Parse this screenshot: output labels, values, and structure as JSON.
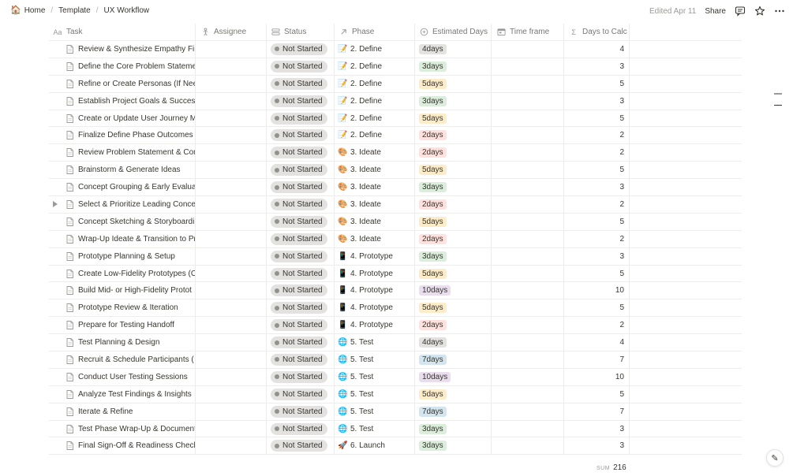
{
  "breadcrumb": {
    "items": [
      {
        "label": "Home",
        "icon": "home-emoji-icon"
      },
      {
        "label": "Template"
      },
      {
        "label": "UX Workflow"
      }
    ],
    "separator": "/"
  },
  "topbar": {
    "edited": "Edited Apr 11",
    "share_label": "Share"
  },
  "columns": [
    {
      "key": "task",
      "label": "Task",
      "icon_text": "Aa"
    },
    {
      "key": "assignee",
      "label": "Assignee",
      "icon": "person-icon"
    },
    {
      "key": "status",
      "label": "Status",
      "icon": "status-icon"
    },
    {
      "key": "phase",
      "label": "Phase",
      "icon": "arrow-up-right-icon"
    },
    {
      "key": "est",
      "label": "Estimated Days",
      "icon": "formula-icon"
    },
    {
      "key": "time",
      "label": "Time frame",
      "icon": "calendar-icon"
    },
    {
      "key": "days",
      "label": "Days to Calc",
      "icon_text": "Σ"
    }
  ],
  "colors": {
    "phase_define": "#f3e7c3",
    "est_4": "#e3e2e0",
    "est_3": "#dbeddb",
    "est_5": "#fdecc8",
    "est_2": "#ffe2dd",
    "est_10": "#e8deee",
    "est_7": "#d3e5ef"
  },
  "rows": [
    {
      "task": "Review & Synthesize Empathy Fin",
      "status": "Not Started",
      "phase_emoji": "📝",
      "phase": "2. Define",
      "est": "4days",
      "est_color": "#e3e2e0",
      "days": "4"
    },
    {
      "task": "Define the Core Problem Stateme",
      "status": "Not Started",
      "phase_emoji": "📝",
      "phase": "2. Define",
      "est": "3days",
      "est_color": "#dbeddb",
      "days": "3"
    },
    {
      "task": "Refine or Create Personas (If Nee",
      "status": "Not Started",
      "phase_emoji": "📝",
      "phase": "2. Define",
      "est": "5days",
      "est_color": "#fdecc8",
      "days": "5"
    },
    {
      "task": "Establish Project Goals & Success",
      "status": "Not Started",
      "phase_emoji": "📝",
      "phase": "2. Define",
      "est": "3days",
      "est_color": "#dbeddb",
      "days": "3"
    },
    {
      "task": "Create or Update User Journey M",
      "status": "Not Started",
      "phase_emoji": "📝",
      "phase": "2. Define",
      "est": "5days",
      "est_color": "#fdecc8",
      "days": "5"
    },
    {
      "task": "Finalize Define Phase Outcomes &",
      "status": "Not Started",
      "phase_emoji": "📝",
      "phase": "2. Define",
      "est": "2days",
      "est_color": "#ffe2dd",
      "days": "2"
    },
    {
      "task": "Review Problem Statement & Con",
      "status": "Not Started",
      "phase_emoji": "🎨",
      "phase": "3. Ideate",
      "est": "2days",
      "est_color": "#ffe2dd",
      "days": "2"
    },
    {
      "task": "Brainstorm & Generate Ideas",
      "status": "Not Started",
      "phase_emoji": "🎨",
      "phase": "3. Ideate",
      "est": "5days",
      "est_color": "#fdecc8",
      "days": "5"
    },
    {
      "task": "Concept Grouping & Early Evaluat",
      "status": "Not Started",
      "phase_emoji": "🎨",
      "phase": "3. Ideate",
      "est": "3days",
      "est_color": "#dbeddb",
      "days": "3"
    },
    {
      "task": "Select & Prioritize Leading Conce",
      "status": "Not Started",
      "phase_emoji": "🎨",
      "phase": "3. Ideate",
      "est": "2days",
      "est_color": "#ffe2dd",
      "days": "2",
      "toggle": true
    },
    {
      "task": "Concept Sketching & Storyboardi",
      "status": "Not Started",
      "phase_emoji": "🎨",
      "phase": "3. Ideate",
      "est": "5days",
      "est_color": "#fdecc8",
      "days": "5"
    },
    {
      "task": "Wrap-Up Ideate & Transition to Pr",
      "status": "Not Started",
      "phase_emoji": "🎨",
      "phase": "3. Ideate",
      "est": "2days",
      "est_color": "#ffe2dd",
      "days": "2"
    },
    {
      "task": "Prototype Planning & Setup",
      "status": "Not Started",
      "phase_emoji": "📱",
      "phase": "4. Prototype",
      "est": "3days",
      "est_color": "#dbeddb",
      "days": "3"
    },
    {
      "task": "Create Low-Fidelity Prototypes (C",
      "status": "Not Started",
      "phase_emoji": "📱",
      "phase": "4. Prototype",
      "est": "5days",
      "est_color": "#fdecc8",
      "days": "5"
    },
    {
      "task": "Build Mid- or High-Fidelity Protot",
      "status": "Not Started",
      "phase_emoji": "📱",
      "phase": "4. Prototype",
      "est": "10days",
      "est_color": "#e8deee",
      "days": "10"
    },
    {
      "task": "Prototype Review & Iteration",
      "status": "Not Started",
      "phase_emoji": "📱",
      "phase": "4. Prototype",
      "est": "5days",
      "est_color": "#fdecc8",
      "days": "5"
    },
    {
      "task": "Prepare for Testing Handoff",
      "status": "Not Started",
      "phase_emoji": "📱",
      "phase": "4. Prototype",
      "est": "2days",
      "est_color": "#ffe2dd",
      "days": "2"
    },
    {
      "task": "Test Planning & Design",
      "status": "Not Started",
      "phase_emoji": "🌐",
      "phase": "5. Test",
      "est": "4days",
      "est_color": "#e3e2e0",
      "days": "4"
    },
    {
      "task": "Recruit & Schedule Participants (",
      "status": "Not Started",
      "phase_emoji": "🌐",
      "phase": "5. Test",
      "est": "7days",
      "est_color": "#d3e5ef",
      "days": "7"
    },
    {
      "task": "Conduct User Testing Sessions",
      "status": "Not Started",
      "phase_emoji": "🌐",
      "phase": "5. Test",
      "est": "10days",
      "est_color": "#e8deee",
      "days": "10"
    },
    {
      "task": "Analyze Test Findings & Insights",
      "status": "Not Started",
      "phase_emoji": "🌐",
      "phase": "5. Test",
      "est": "5days",
      "est_color": "#fdecc8",
      "days": "5"
    },
    {
      "task": "Iterate & Refine",
      "status": "Not Started",
      "phase_emoji": "🌐",
      "phase": "5. Test",
      "est": "7days",
      "est_color": "#d3e5ef",
      "days": "7"
    },
    {
      "task": "Test Phase Wrap-Up & Document",
      "status": "Not Started",
      "phase_emoji": "🌐",
      "phase": "5. Test",
      "est": "3days",
      "est_color": "#dbeddb",
      "days": "3"
    },
    {
      "task": "Final Sign-Off & Readiness Check",
      "status": "Not Started",
      "phase_emoji": "🚀",
      "phase": "6. Launch",
      "est": "3days",
      "est_color": "#dbeddb",
      "days": "3"
    }
  ],
  "footer": {
    "sum_label": "SUM",
    "sum_value": "216"
  }
}
